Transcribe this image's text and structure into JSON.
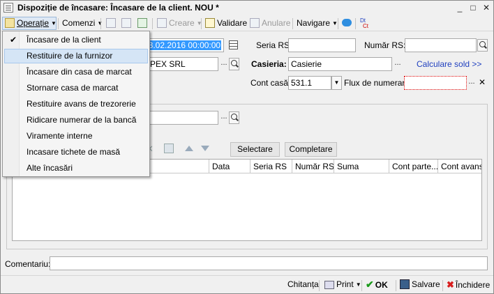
{
  "window": {
    "title": "Dispoziție de încasare: Încasare de la client. NOU *",
    "minimize": "_",
    "maximize": "□",
    "close": "✕"
  },
  "toolbar": {
    "operatie": "Operație",
    "comenzi": "Comenzi",
    "creare": "Creare",
    "validare": "Validare",
    "anulare": "Anulare",
    "navigare": "Navigare",
    "dtct_top": "Dt",
    "dtct_bottom": "Ct"
  },
  "menu": {
    "items": [
      {
        "label": "Încasare de la client",
        "checked": true
      },
      {
        "label": "Restituire de la furnizor",
        "hover": true
      },
      {
        "label": "Încasare din casa de marcat"
      },
      {
        "label": "Stornare casa de marcat"
      },
      {
        "label": "Restituire avans de trezorerie"
      },
      {
        "label": "Ridicare numerar de la bancă"
      },
      {
        "label": "Viramente interne"
      },
      {
        "label": "Incasare tichete de masă"
      },
      {
        "label": "Alte încasări"
      }
    ],
    "check_glyph": "✔"
  },
  "form": {
    "date_value": "03.02.2016 00:00:00",
    "partner_value": "MPEX SRL",
    "seria_rs_label": "Seria RS:",
    "seria_rs_value": "",
    "numar_rs_label": "Număr RS:",
    "numar_rs_value": "",
    "casieria_label": "Casieria:",
    "casieria_value": "Casierie",
    "calculare_sold": "Calculare sold >>",
    "cont_casa_label": "Cont casă:",
    "cont_casa_value": "531.1",
    "flux_label": "Flux de numerar:",
    "flux_value": "",
    "dots": "..."
  },
  "table": {
    "selectare": "Selectare",
    "completare": "Completare",
    "columns": [
      "Data",
      "Seria RS",
      "Număr RS",
      "Suma",
      "Cont parte...",
      "Cont avans"
    ]
  },
  "comment": {
    "label": "Comentariu:",
    "value": ""
  },
  "footer": {
    "chitanta": "Chitanța",
    "print": "Print",
    "ok": "OK",
    "salvare": "Salvare",
    "inchidere": "Închidere"
  },
  "colors": {
    "accent": "#3399ff",
    "link": "#1f3fbf",
    "ok_green": "#1a9a1a",
    "close_red": "#d81e1e"
  }
}
